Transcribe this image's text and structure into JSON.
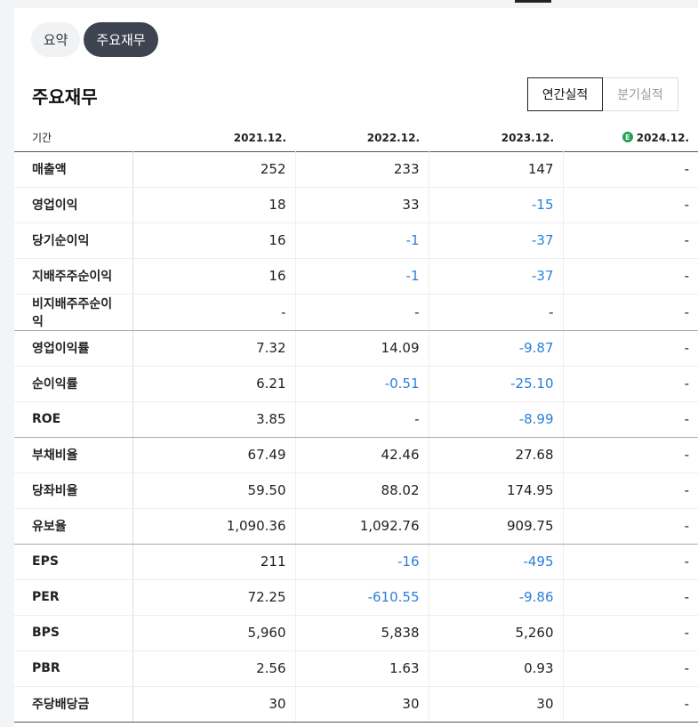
{
  "tabs": [
    {
      "label": "요약",
      "active": false
    },
    {
      "label": "주요재무",
      "active": true
    }
  ],
  "section": {
    "title": "주요재무",
    "toggles": [
      {
        "label": "연간실적",
        "active": true
      },
      {
        "label": "분기실적",
        "active": false
      }
    ]
  },
  "table": {
    "period_label": "기간",
    "columns": [
      "2021.12.",
      "2022.12.",
      "2023.12.",
      "2024.12."
    ],
    "estimate_badge": "E",
    "rows": [
      {
        "label": "매출액",
        "values": [
          "252",
          "233",
          "147",
          "-"
        ]
      },
      {
        "label": "영업이익",
        "values": [
          "18",
          "33",
          "-15",
          "-"
        ]
      },
      {
        "label": "당기순이익",
        "values": [
          "16",
          "-1",
          "-37",
          "-"
        ]
      },
      {
        "label": "지배주주순이익",
        "values": [
          "16",
          "-1",
          "-37",
          "-"
        ]
      },
      {
        "label": "비지배주주순이익",
        "values": [
          "-",
          "-",
          "-",
          "-"
        ]
      },
      {
        "label": "영업이익률",
        "values": [
          "7.32",
          "14.09",
          "-9.87",
          "-"
        ]
      },
      {
        "label": "순이익률",
        "values": [
          "6.21",
          "-0.51",
          "-25.10",
          "-"
        ]
      },
      {
        "label": "ROE",
        "values": [
          "3.85",
          "-",
          "-8.99",
          "-"
        ]
      },
      {
        "label": "부채비율",
        "values": [
          "67.49",
          "42.46",
          "27.68",
          "-"
        ]
      },
      {
        "label": "당좌비율",
        "values": [
          "59.50",
          "88.02",
          "174.95",
          "-"
        ]
      },
      {
        "label": "유보율",
        "values": [
          "1,090.36",
          "1,092.76",
          "909.75",
          "-"
        ]
      },
      {
        "label": "EPS",
        "values": [
          "211",
          "-16",
          "-495",
          "-"
        ]
      },
      {
        "label": "PER",
        "values": [
          "72.25",
          "-610.55",
          "-9.86",
          "-"
        ]
      },
      {
        "label": "BPS",
        "values": [
          "5,960",
          "5,838",
          "5,260",
          "-"
        ]
      },
      {
        "label": "PBR",
        "values": [
          "2.56",
          "1.63",
          "0.93",
          "-"
        ]
      },
      {
        "label": "주당배당금",
        "values": [
          "30",
          "30",
          "30",
          "-"
        ]
      }
    ]
  },
  "colors": {
    "negative": "#2a7fd9",
    "active_pill": "#3d4450",
    "estimate_badge": "#1fa352"
  }
}
